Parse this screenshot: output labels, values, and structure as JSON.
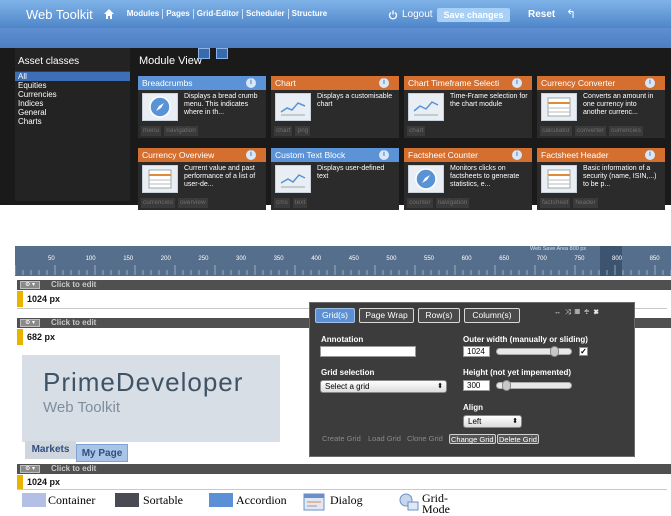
{
  "topbar": {
    "brand": "Web Toolkit",
    "nav": [
      "Modules",
      "Pages",
      "Grid-Editor",
      "Scheduler",
      "Structure"
    ],
    "logout": "Logout",
    "save": "Save changes",
    "reset": "Reset"
  },
  "sidebar": {
    "title": "Asset classes",
    "items": [
      "All",
      "Equities",
      "Currencies",
      "Indices",
      "General",
      "Charts"
    ]
  },
  "module_view": {
    "title": "Module View"
  },
  "cards": [
    {
      "title": "Breadcrumbs",
      "desc": "Displays a bread crumb menu. This indicates where in th...",
      "tags": [
        "menu",
        "navigation"
      ]
    },
    {
      "title": "Chart",
      "desc": "Displays a customisable chart",
      "tags": [
        "chart",
        "png"
      ]
    },
    {
      "title": "Chart Timeframe Selecti",
      "desc": "Time-Frame selection for the chart module",
      "tags": [
        "chart"
      ]
    },
    {
      "title": "Currency Converter",
      "desc": "Converts an amount in one currency into another currenc...",
      "tags": [
        "calculator",
        "converter",
        "currencies"
      ]
    },
    {
      "title": "Currency Overview",
      "desc": "Current value and past performance of a list of user-de...",
      "tags": [
        "currencies",
        "overview"
      ]
    },
    {
      "title": "Custom Text Block",
      "desc": "Displays user-defined text",
      "tags": [
        "cms",
        "text"
      ]
    },
    {
      "title": "Factsheet Counter",
      "desc": "Monitors clicks on factsheets to generate statistics, e...",
      "tags": [
        "counter",
        "navigation"
      ]
    },
    {
      "title": "Factsheet Header",
      "desc": "Basic information of a security (name, ISIN,...) to be p...",
      "tags": [
        "factsheet",
        "header"
      ]
    }
  ],
  "ruler": {
    "labels": [
      "50",
      "100",
      "150",
      "200",
      "250",
      "300",
      "350",
      "400",
      "450",
      "500",
      "550",
      "600",
      "650",
      "700",
      "750",
      "800",
      "850"
    ],
    "safe_area": "Web Save Area 800 px"
  },
  "rows": [
    {
      "click": "Click to edit",
      "px": "1024 px"
    },
    {
      "click": "Click to edit",
      "px": "682 px"
    },
    {
      "click": "Click to edit",
      "px": "1024 px"
    }
  ],
  "logo": {
    "big": "PrimeDeveloper",
    "small": "Web Toolkit"
  },
  "page_tabs": {
    "markets": "Markets",
    "mypage": "My Page"
  },
  "dialog": {
    "tabs": [
      "Grid(s)",
      "Page Wrap",
      "Row(s)",
      "Column(s)"
    ],
    "annotation_label": "Annotation",
    "annotation_value": "",
    "grid_selection_label": "Grid selection",
    "grid_selection_value": "Select a grid",
    "outer_width_label": "Outer width (manually or sliding)",
    "outer_width_value": "1024",
    "outer_width_checked": true,
    "height_label": "Height (not yet impemented)",
    "height_value": "300",
    "align_label": "Align",
    "align_value": "Left",
    "buttons": [
      "Create Grid",
      "Load Grid",
      "Clone Grid",
      "Change Grid",
      "Delete Grid"
    ]
  },
  "legend": {
    "items": [
      {
        "label": "Container",
        "color": "#b4bfe6"
      },
      {
        "label": "Sortable",
        "color": "#4a4a55"
      },
      {
        "label": "Accordion",
        "color": "#5b8fd6"
      },
      {
        "label": "Dialog",
        "color": "#e0e8f5"
      },
      {
        "label": "Grid-Mode",
        "color": "#e0e8f5"
      }
    ]
  }
}
